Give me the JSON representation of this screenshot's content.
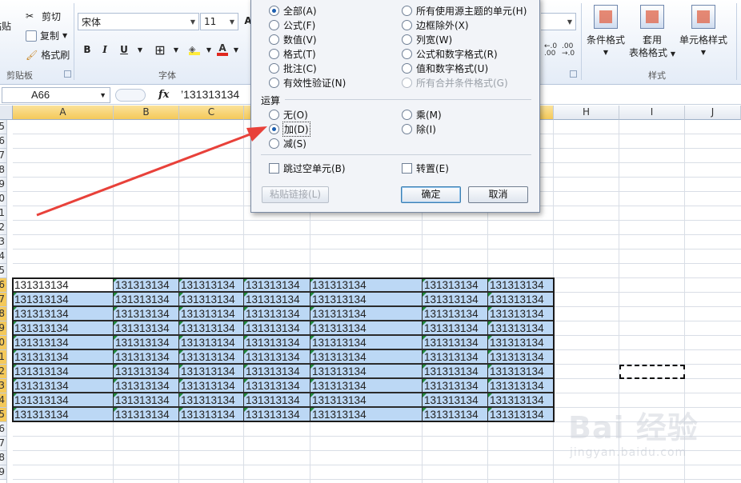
{
  "ribbon": {
    "clipboard": {
      "paste": "粘贴",
      "cut": "剪切",
      "copy": "复制",
      "format_painter": "格式刷",
      "group": "剪贴板"
    },
    "font": {
      "name": "宋体",
      "size": "11",
      "grow": "A",
      "group": "字体",
      "bold": "B",
      "italic": "I",
      "underline": "U"
    },
    "number": {
      "inc_decimal": ".00 +.0",
      "dec_decimal": ".00 +.0"
    },
    "styles": {
      "conditional": "条件格式",
      "table_line1": "套用",
      "table_line2": "表格格式",
      "cell_styles": "单元格样式",
      "group": "样式"
    }
  },
  "formula_bar": {
    "name_box": "A66",
    "fx": "fx",
    "value": "’131313134"
  },
  "grid": {
    "columns": [
      "A",
      "B",
      "C",
      "",
      "",
      "",
      "",
      "H",
      "I",
      "J"
    ],
    "rows": [
      "5",
      "6",
      "7",
      "8",
      "9",
      "0",
      "1",
      "2",
      "3",
      "4",
      "5",
      "6",
      "7",
      "8",
      "9",
      "0",
      "1",
      "2",
      "3",
      "4",
      "5",
      "6",
      "7",
      "8",
      "9"
    ],
    "cell_value": "131313134"
  },
  "dialog": {
    "paste_options": {
      "left": [
        "全部(A)",
        "公式(F)",
        "数值(V)",
        "格式(T)",
        "批注(C)",
        "有效性验证(N)"
      ],
      "right": [
        "所有使用源主题的单元(H)",
        "边框除外(X)",
        "列宽(W)",
        "公式和数字格式(R)",
        "值和数字格式(U)",
        "所有合并条件格式(G)"
      ]
    },
    "operation_title": "运算",
    "operations": {
      "none": "无(O)",
      "add": "加(D)",
      "subtract": "减(S)",
      "multiply": "乘(M)",
      "divide": "除(I)"
    },
    "skip_blanks": "跳过空单元(B)",
    "transpose": "转置(E)",
    "paste_link": "粘贴链接(L)",
    "ok": "确定",
    "cancel": "取消"
  },
  "watermark": {
    "main": "Bai 经验",
    "sub": "jingyan.baidu.com"
  },
  "colors": {
    "selection_fill": "#bcd8f5",
    "header_highlight": "#f4c95a",
    "arrow": "#e8413a",
    "error_triangle": "#1f8a3b"
  }
}
